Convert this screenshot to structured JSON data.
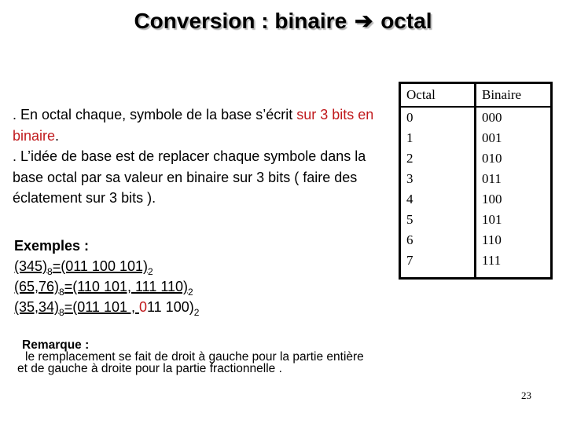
{
  "title": {
    "left": "Conversion : binaire",
    "arrow": "➔",
    "right": "octal"
  },
  "intro": {
    "p1_black": ". En octal chaque, symbole de la base s’écrit ",
    "p1_red": "sur 3 bits en binaire",
    "p1_end": ".",
    "p2": ". L’idée de base est de replacer chaque symbole dans la base octal par sa valeur en binaire sur 3 bits ( faire des  éclatement sur 3 bits )."
  },
  "examples": {
    "heading": "Exemples :",
    "items": [
      {
        "lhs": "(345)",
        "lhs_base": "8",
        "rhs": "=(011 100 101)",
        "rhs_base": "2"
      },
      {
        "lhs": "(65,76)",
        "lhs_base": "8",
        "rhs": "=(110 101, 111 110)",
        "rhs_base": "2"
      },
      {
        "lhs": "(35,34)",
        "lhs_base": "8",
        "rhs_a": "=(011 101 , ",
        "rhs_red": "0",
        "rhs_b": "11 100)",
        "rhs_base": "2"
      }
    ]
  },
  "table": {
    "headers": [
      "Octal",
      "Binaire"
    ],
    "rows": [
      [
        "0",
        "000"
      ],
      [
        "1",
        "001"
      ],
      [
        "2",
        "010"
      ],
      [
        "3",
        "011"
      ],
      [
        "4",
        "100"
      ],
      [
        "5",
        "101"
      ],
      [
        "6",
        "110"
      ],
      [
        "7",
        "111"
      ]
    ]
  },
  "remark": {
    "heading": "Remarque :",
    "line1": "le remplacement se fait de droit à gauche pour la partie entière",
    "line2": "et de gauche à droite pour la partie fractionnelle ."
  },
  "page_number": "23",
  "colors": {
    "accent_red": "#c0191c"
  }
}
